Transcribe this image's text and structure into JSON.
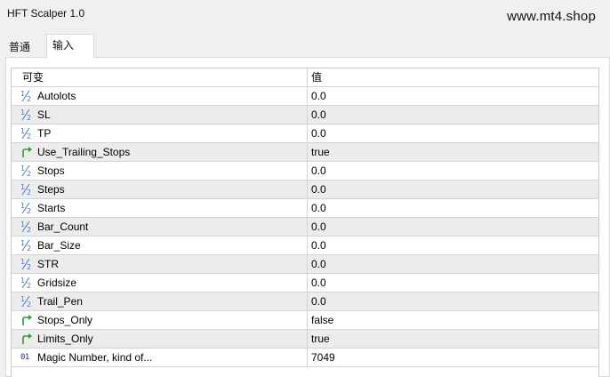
{
  "window": {
    "title": "HFT Scalper 1.0",
    "watermark": "www.mt4.shop"
  },
  "tabs": [
    {
      "label": "普通"
    },
    {
      "label": "输入"
    }
  ],
  "table": {
    "columns": {
      "name": "可变",
      "value": "值"
    },
    "rows": [
      {
        "icon": "fraction-icon",
        "name": "Autolots",
        "value": "0.0"
      },
      {
        "icon": "fraction-icon",
        "name": "SL",
        "value": "0.0"
      },
      {
        "icon": "fraction-icon",
        "name": "TP",
        "value": "0.0"
      },
      {
        "icon": "boolean-arrow-icon",
        "name": "Use_Trailing_Stops",
        "value": "true"
      },
      {
        "icon": "fraction-icon",
        "name": "Stops",
        "value": "0.0"
      },
      {
        "icon": "fraction-icon",
        "name": "Steps",
        "value": "0.0"
      },
      {
        "icon": "fraction-icon",
        "name": "Starts",
        "value": "0.0"
      },
      {
        "icon": "fraction-icon",
        "name": "Bar_Count",
        "value": "0.0"
      },
      {
        "icon": "fraction-icon",
        "name": "Bar_Size",
        "value": "0.0"
      },
      {
        "icon": "fraction-icon",
        "name": "STR",
        "value": "0.0"
      },
      {
        "icon": "fraction-icon",
        "name": "Gridsize",
        "value": "0.0"
      },
      {
        "icon": "fraction-icon",
        "name": "Trail_Pen",
        "value": "0.0"
      },
      {
        "icon": "boolean-arrow-icon",
        "name": "Stops_Only",
        "value": "false"
      },
      {
        "icon": "boolean-arrow-icon",
        "name": "Limits_Only",
        "value": "true"
      },
      {
        "icon": "integer-icon",
        "icon_text": "01",
        "name": "Magic Number, kind of...",
        "value": "7049"
      }
    ]
  },
  "colors": {
    "boolean_icon": "#2e9d2e",
    "fraction_icon": "#3b7ad6",
    "row_alt": "#ececec"
  }
}
